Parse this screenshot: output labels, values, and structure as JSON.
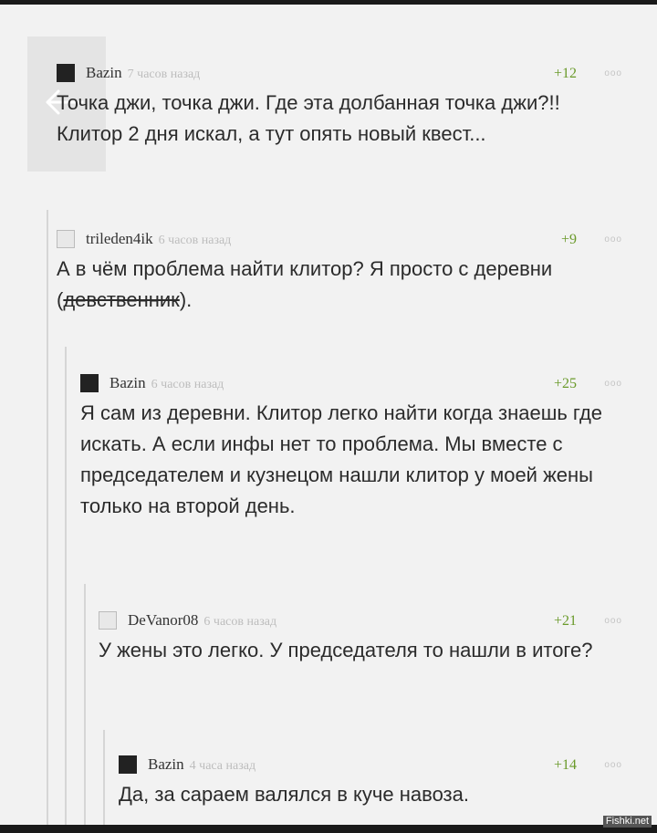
{
  "comments": [
    {
      "user": "Bazin",
      "time": "7 часов назад",
      "score": "+12",
      "more": "ooo",
      "text": "Точка джи, точка джи. Где эта долбанная точка джи?!! Клитор 2 дня искал, а тут опять новый квест..."
    },
    {
      "user": "trileden4ik",
      "time": "6 часов назад",
      "score": "+9",
      "more": "ooo",
      "text_before": "А в чём проблема найти клитор? Я просто с деревни (",
      "text_strike": "девственник",
      "text_after": ")."
    },
    {
      "user": "Bazin",
      "time": "6 часов назад",
      "score": "+25",
      "more": "ooo",
      "text": "Я сам из деревни. Клитор легко найти когда знаешь где искать. А если инфы нет то проблема. Мы вместе с председателем и кузнецом нашли клитор у моей жены только на второй день."
    },
    {
      "user": "DeVanor08",
      "time": "6 часов назад",
      "score": "+21",
      "more": "ooo",
      "text": "У жены это легко. У председателя то нашли в итоге?"
    },
    {
      "user": "Bazin",
      "time": "4 часа назад",
      "score": "+14",
      "more": "ooo",
      "text": "Да, за сараем валялся в куче навоза."
    }
  ],
  "watermark": "Fishki.net"
}
